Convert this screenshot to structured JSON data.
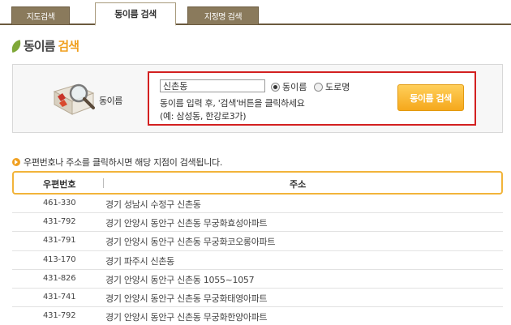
{
  "tabs": [
    {
      "label": "지도검색",
      "active": false
    },
    {
      "label": "동이름 검색",
      "active": true
    },
    {
      "label": "지정명 검색",
      "active": false
    }
  ],
  "section": {
    "title_dark": "동이름",
    "title_accent": "검색"
  },
  "search": {
    "label": "동이름",
    "input_value": "신촌동",
    "radio_options": [
      {
        "label": "동이름",
        "selected": true
      },
      {
        "label": "도로명",
        "selected": false
      }
    ],
    "help_line1": "동이름 입력 후, '검색'버튼을 클릭하세요",
    "help_line2": "(예: 삼성동, 한강로3가)",
    "button_label": "동이름 검색"
  },
  "notice": "우편번호나 주소를 클릭하시면 해당 지점이 검색됩니다.",
  "table": {
    "headers": [
      "우편번호",
      "주소"
    ],
    "rows": [
      {
        "zip": "461-330",
        "address": "경기 성남시 수정구 신촌동"
      },
      {
        "zip": "431-792",
        "address": "경기 안양시 동안구 신촌동 무궁화효성아파트"
      },
      {
        "zip": "431-791",
        "address": "경기 안양시 동안구 신촌동 무궁화코오롱아파트"
      },
      {
        "zip": "413-170",
        "address": "경기 파주시 신촌동"
      },
      {
        "zip": "431-826",
        "address": "경기 안양시 동안구 신촌동 1055~1057"
      },
      {
        "zip": "431-741",
        "address": "경기 안양시 동안구 신촌동 무궁화태영아파트"
      },
      {
        "zip": "431-792",
        "address": "경기 안양시 동안구 신촌동 무궁화한양아파트"
      }
    ]
  },
  "colors": {
    "accent": "#f0a020",
    "highlight_border": "#d32020",
    "tab_bg": "#8a7a5c"
  }
}
